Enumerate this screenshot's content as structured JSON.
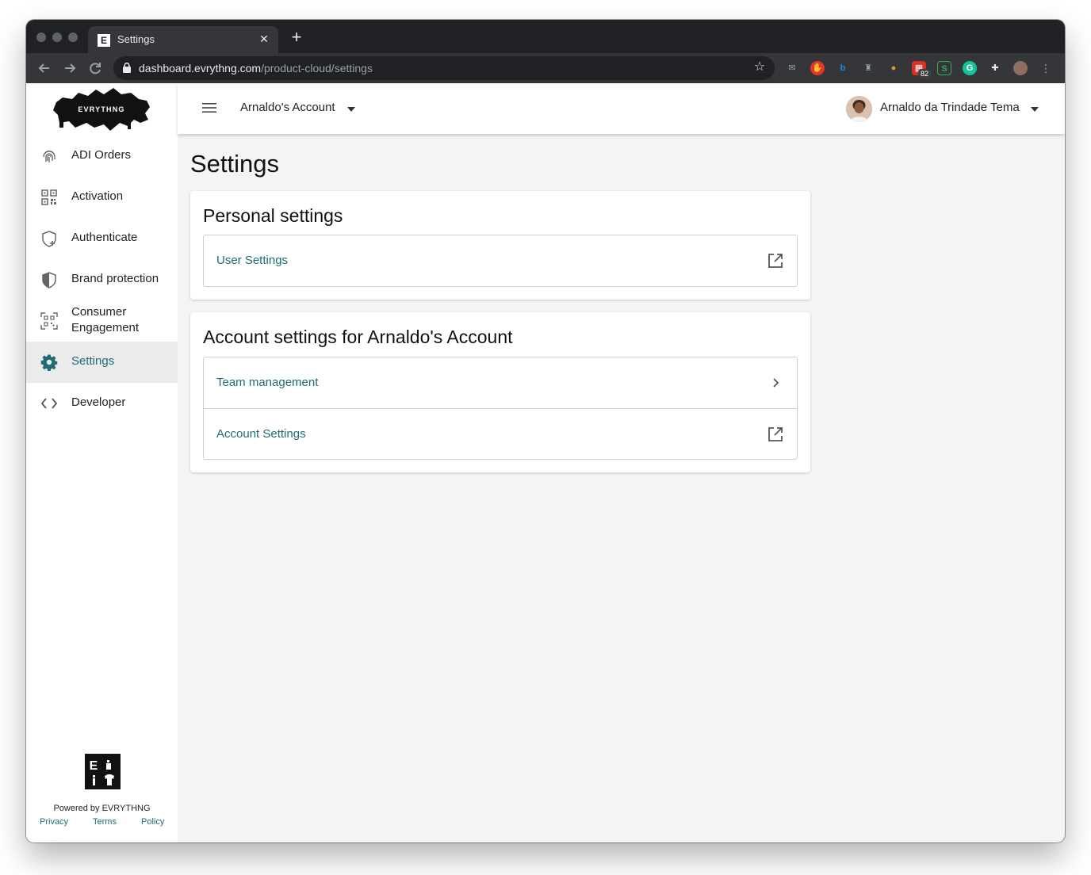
{
  "browser": {
    "tab_title": "Settings",
    "tab_favicon": "E",
    "tab_close": "✕",
    "new_tab": "+",
    "url_host": "dashboard.evrythng.com",
    "url_path": "/product-cloud/settings",
    "extension_badge": "82"
  },
  "sidebar": {
    "items": [
      {
        "label": "ADI Orders",
        "icon": "fingerprint-icon"
      },
      {
        "label": "Activation",
        "icon": "qr-code-icon"
      },
      {
        "label": "Authenticate",
        "icon": "shield-plus-icon"
      },
      {
        "label": "Brand protection",
        "icon": "shield-half-icon"
      },
      {
        "label": "Consumer",
        "label2": "Engagement",
        "icon": "qr-scan-icon"
      },
      {
        "label": "Settings",
        "icon": "gear-icon"
      },
      {
        "label": "Developer",
        "icon": "code-icon"
      }
    ],
    "logo_text": "EVRYTHNG",
    "powered_by": "Powered by EVRYTHNG",
    "footer_links": [
      "Privacy",
      "Terms",
      "Policy"
    ]
  },
  "header": {
    "account": "Arnaldo's Account",
    "user_name": "Arnaldo da Trindade Tema"
  },
  "main": {
    "title": "Settings",
    "personal": {
      "title": "Personal settings",
      "rows": [
        {
          "label": "User Settings",
          "icon": "external-link-icon"
        }
      ]
    },
    "account": {
      "title": "Account settings for Arnaldo's Account",
      "rows": [
        {
          "label": "Team management",
          "icon": "chevron-right-icon"
        },
        {
          "label": "Account Settings",
          "icon": "external-link-icon"
        }
      ]
    }
  },
  "colors": {
    "accent": "#1f6b73",
    "sidebar_active_bg": "#ebebeb",
    "content_bg": "#f4f4f4"
  }
}
